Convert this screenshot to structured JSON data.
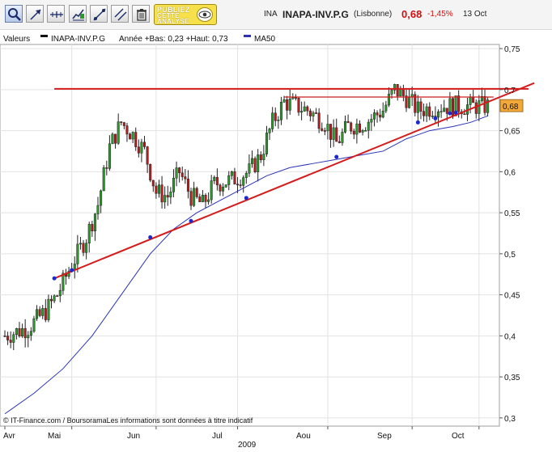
{
  "toolbar": {
    "buttons": [
      {
        "name": "zoom-tool-button",
        "icon": "magnifier-icon"
      },
      {
        "name": "select-tool-button",
        "icon": "diagonal-arrow-icon"
      },
      {
        "name": "crosshair-tool-button",
        "icon": "crosshair-icon"
      },
      {
        "name": "indicator-tool-button",
        "icon": "chart-indicator-icon"
      },
      {
        "name": "line-draw-tool-button",
        "icon": "trend-line-icon"
      },
      {
        "name": "parallel-line-tool-button",
        "icon": "parallel-line-icon"
      },
      {
        "name": "delete-tool-button",
        "icon": "trash-icon"
      }
    ],
    "promo_line1": "PUBLIEZ",
    "promo_line2": "CETTE",
    "promo_line3": "ANALYSE"
  },
  "header": {
    "code": "INA",
    "name": "INAPA-INV.P.G",
    "exchange": "(Lisbonne)",
    "price": "0,68",
    "change_pct": "-1,45%",
    "date": "13 Oct"
  },
  "legend": {
    "prefix": "Valeurs",
    "series_name": "INAPA-INV.P.G",
    "stats": "Année +Bas: 0,23 +Haut: 0,73",
    "ma_name": "MA50"
  },
  "footer": {
    "credit": "© IT-Finance.com / BoursoramaLes informations sont données à titre indicatif",
    "year": "2009"
  },
  "colors": {
    "up": "#2a9a2a",
    "down": "#b81c1c",
    "ma": "#2a33b8",
    "trend": "#d41c1c",
    "last_price_box": "#f2a93a"
  },
  "chart_data": {
    "type": "candlestick",
    "ylim": [
      0.29,
      0.755
    ],
    "y_ticks": [
      "0,75",
      "0,7",
      "0,65",
      "0,6",
      "0,55",
      "0,5",
      "0,45",
      "0,4",
      "0,35",
      "0,3"
    ],
    "x_labels": [
      "Avr",
      "Mai",
      "Jun",
      "Jul",
      "Aou",
      "Sep",
      "Oct"
    ],
    "last_price_label": "0,68",
    "last_price": 0.68,
    "moving_average": {
      "name": "MA50",
      "points": [
        [
          0,
          0.305
        ],
        [
          10,
          0.33
        ],
        [
          20,
          0.36
        ],
        [
          30,
          0.4
        ],
        [
          40,
          0.45
        ],
        [
          50,
          0.5
        ],
        [
          58,
          0.53
        ],
        [
          66,
          0.55
        ],
        [
          74,
          0.565
        ],
        [
          82,
          0.58
        ],
        [
          90,
          0.595
        ],
        [
          98,
          0.605
        ],
        [
          106,
          0.61
        ],
        [
          114,
          0.615
        ],
        [
          122,
          0.62
        ],
        [
          130,
          0.625
        ],
        [
          138,
          0.64
        ],
        [
          146,
          0.65
        ],
        [
          154,
          0.655
        ],
        [
          160,
          0.66
        ],
        [
          166,
          0.668
        ]
      ]
    },
    "trend_lines": [
      {
        "name": "support",
        "from": [
          17,
          0.47
        ],
        "to": [
          182,
          0.708
        ]
      },
      {
        "name": "resistance",
        "from": [
          17,
          0.701
        ],
        "to": [
          180,
          0.701
        ]
      },
      {
        "name": "channel-top",
        "from": [
          96,
          0.691
        ],
        "to": [
          168,
          0.691
        ]
      }
    ],
    "support_touches": [
      [
        17,
        0.47
      ],
      [
        23,
        0.48
      ],
      [
        50,
        0.52
      ],
      [
        64,
        0.54
      ],
      [
        83,
        0.568
      ],
      [
        114,
        0.618
      ],
      [
        142,
        0.66
      ],
      [
        148,
        0.665
      ],
      [
        153,
        0.671
      ],
      [
        155,
        0.672
      ]
    ],
    "candles": []
  }
}
